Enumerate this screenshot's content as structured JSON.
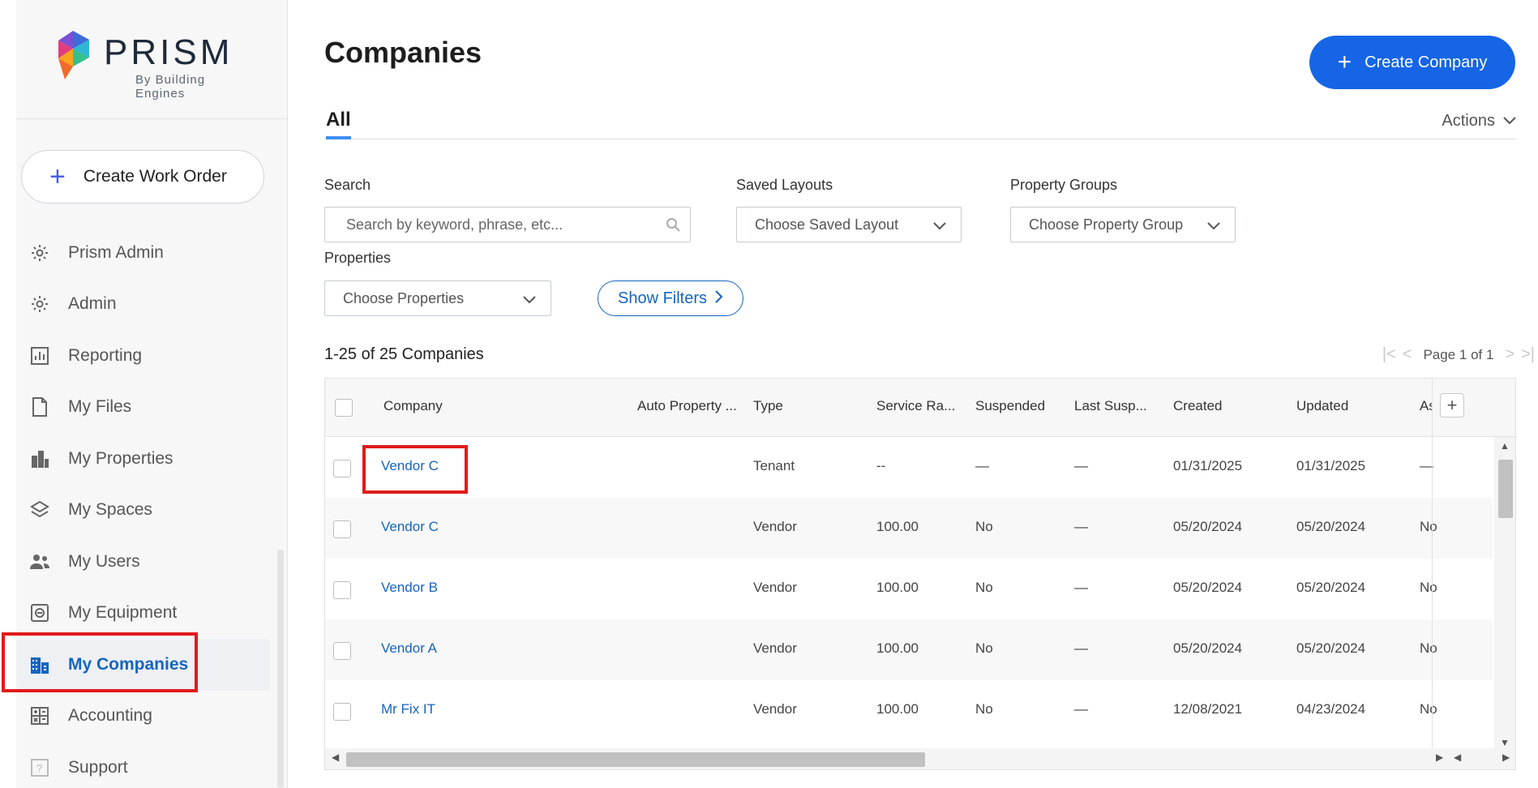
{
  "logo": {
    "name": "PRISM",
    "subtitle": "By Building Engines"
  },
  "sidebar": {
    "create_label": "Create Work Order",
    "items": [
      {
        "label": "Prism Admin",
        "icon": "gear-icon"
      },
      {
        "label": "Admin",
        "icon": "gear-icon"
      },
      {
        "label": "Reporting",
        "icon": "chart-icon"
      },
      {
        "label": "My Files",
        "icon": "file-icon"
      },
      {
        "label": "My Properties",
        "icon": "building-icon"
      },
      {
        "label": "My Spaces",
        "icon": "layers-icon"
      },
      {
        "label": "My Users",
        "icon": "users-icon"
      },
      {
        "label": "My Equipment",
        "icon": "equipment-icon"
      },
      {
        "label": "My Companies",
        "icon": "company-icon",
        "active": true
      },
      {
        "label": "Accounting",
        "icon": "calculator-icon"
      },
      {
        "label": "Support",
        "icon": "help-icon"
      }
    ]
  },
  "header": {
    "title": "Companies",
    "create_label": "Create Company",
    "tab_all": "All",
    "actions_label": "Actions"
  },
  "filters": {
    "search_label": "Search",
    "search_placeholder": "Search by keyword, phrase, etc...",
    "saved_layouts_label": "Saved Layouts",
    "saved_layouts_value": "Choose Saved Layout",
    "property_groups_label": "Property Groups",
    "property_groups_value": "Choose Property Group",
    "properties_label": "Properties",
    "properties_value": "Choose Properties",
    "show_filters": "Show Filters"
  },
  "results": {
    "count_text": "1-25 of 25 Companies",
    "page_text": "Page 1 of 1"
  },
  "table": {
    "columns": [
      "Company",
      "Auto Property ...",
      "Type",
      "Service Ra...",
      "Suspended",
      "Last Susp...",
      "Created",
      "Updated",
      "Asso"
    ],
    "rows": [
      {
        "company": "Vendor C",
        "auto_property": "",
        "type": "Tenant",
        "service_rate": "--",
        "suspended": "—",
        "last_suspended": "—",
        "created": "01/31/2025",
        "updated": "01/31/2025",
        "associated": "—"
      },
      {
        "company": "Vendor C",
        "auto_property": "",
        "type": "Vendor",
        "service_rate": "100.00",
        "suspended": "No",
        "last_suspended": "—",
        "created": "05/20/2024",
        "updated": "05/20/2024",
        "associated": "No"
      },
      {
        "company": "Vendor B",
        "auto_property": "",
        "type": "Vendor",
        "service_rate": "100.00",
        "suspended": "No",
        "last_suspended": "—",
        "created": "05/20/2024",
        "updated": "05/20/2024",
        "associated": "No"
      },
      {
        "company": "Vendor A",
        "auto_property": "",
        "type": "Vendor",
        "service_rate": "100.00",
        "suspended": "No",
        "last_suspended": "—",
        "created": "05/20/2024",
        "updated": "05/20/2024",
        "associated": "No"
      },
      {
        "company": "Mr Fix IT",
        "auto_property": "",
        "type": "Vendor",
        "service_rate": "100.00",
        "suspended": "No",
        "last_suspended": "—",
        "created": "12/08/2021",
        "updated": "04/23/2024",
        "associated": "No"
      }
    ]
  },
  "colors": {
    "accent": "#1565e6",
    "link": "#1565c0",
    "highlight": "#e01b1b"
  }
}
